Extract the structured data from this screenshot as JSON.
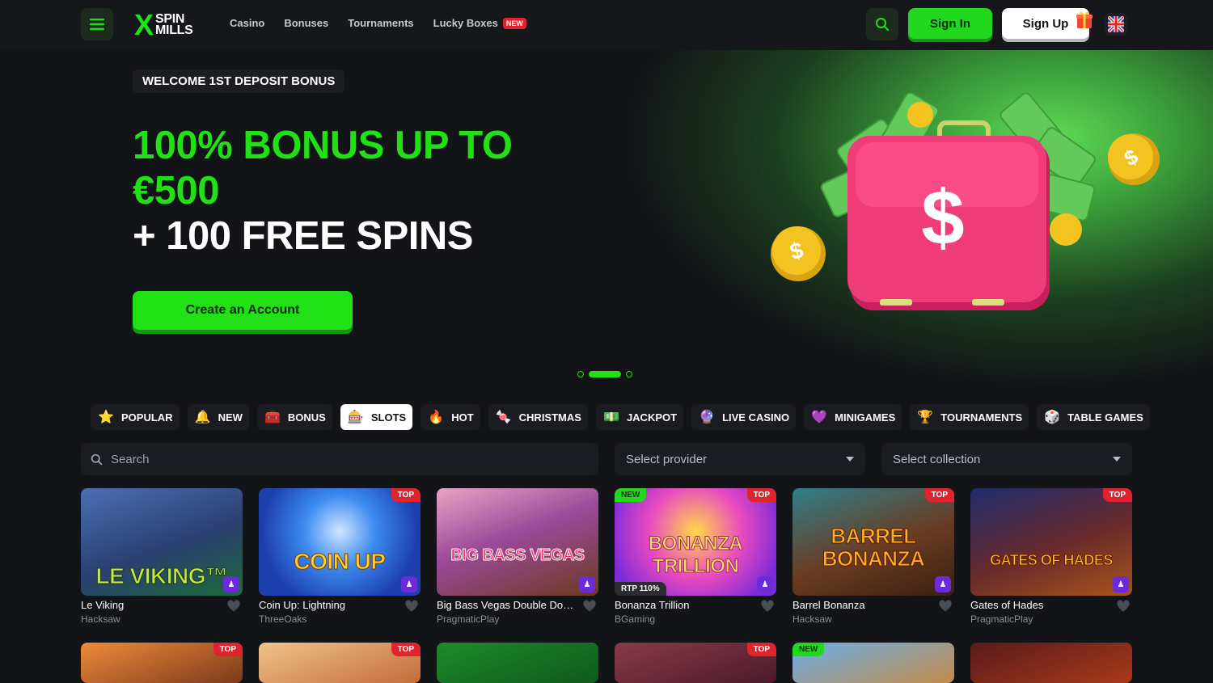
{
  "header": {
    "logo_x": "X",
    "logo_line1": "SPIN",
    "logo_line2": "MILLS",
    "nav": [
      {
        "label": "Casino"
      },
      {
        "label": "Bonuses"
      },
      {
        "label": "Tournaments"
      },
      {
        "label": "Lucky Boxes",
        "badge": "NEW"
      }
    ],
    "sign_in": "Sign In",
    "sign_up": "Sign Up",
    "icons": {
      "menu": "hamburger-icon",
      "search": "search-icon",
      "gift": "gift-icon",
      "language": "uk-flag-icon"
    }
  },
  "hero": {
    "tag": "WELCOME 1ST DEPOSIT BONUS",
    "headline_green": "100% BONUS UP TO €500",
    "headline_white": "+ 100 FREE SPINS",
    "cta": "Create an Account",
    "slides": 3,
    "active_slide": 2,
    "accent": "#22e016"
  },
  "tabs": [
    {
      "label": "POPULAR",
      "icon": "star-icon",
      "active": false
    },
    {
      "label": "NEW",
      "icon": "bell-icon",
      "active": false
    },
    {
      "label": "BONUS",
      "icon": "treasure-chest-icon",
      "active": false
    },
    {
      "label": "SLOTS",
      "icon": "slot-machine-icon",
      "active": true
    },
    {
      "label": "HOT",
      "icon": "fire-icon",
      "active": false
    },
    {
      "label": "CHRISTMAS",
      "icon": "candy-cane-icon",
      "active": false
    },
    {
      "label": "JACKPOT",
      "icon": "money-icon",
      "active": false
    },
    {
      "label": "LIVE CASINO",
      "icon": "crystal-ball-icon",
      "active": false
    },
    {
      "label": "MINIGAMES",
      "icon": "gem-icon",
      "active": false
    },
    {
      "label": "TOURNAMENTS",
      "icon": "trophy-icon",
      "active": false
    },
    {
      "label": "TABLE GAMES",
      "icon": "dice-icon",
      "active": false
    }
  ],
  "filters": {
    "search_placeholder": "Search",
    "provider_placeholder": "Select provider",
    "collection_placeholder": "Select collection"
  },
  "games": [
    {
      "name": "Le Viking",
      "provider": "Hacksaw",
      "art": "LE VIKING™",
      "top": false,
      "new": false,
      "rtp": ""
    },
    {
      "name": "Coin Up: Lightning",
      "provider": "ThreeOaks",
      "art": "COIN UP",
      "top": true,
      "new": false,
      "rtp": ""
    },
    {
      "name": "Big Bass Vegas Double Down Deluxe",
      "provider": "PragmaticPlay",
      "art": "BIG BASS VEGAS",
      "top": false,
      "new": false,
      "rtp": ""
    },
    {
      "name": "Bonanza Trillion",
      "provider": "BGaming",
      "art": "BONANZA TRILLION",
      "top": true,
      "new": true,
      "rtp": "RTP 110%"
    },
    {
      "name": "Barrel Bonanza",
      "provider": "Hacksaw",
      "art": "BARREL BONANZA",
      "top": true,
      "new": false,
      "rtp": ""
    },
    {
      "name": "Gates of Hades",
      "provider": "PragmaticPlay",
      "art": "GATES OF HADES",
      "top": true,
      "new": false,
      "rtp": ""
    }
  ],
  "games_row2": [
    {
      "top": true,
      "new": false
    },
    {
      "top": true,
      "new": false
    },
    {
      "top": false,
      "new": false
    },
    {
      "top": true,
      "new": false
    },
    {
      "top": false,
      "new": true
    },
    {
      "top": false,
      "new": false
    }
  ],
  "labels": {
    "top": "TOP",
    "new": "NEW"
  }
}
